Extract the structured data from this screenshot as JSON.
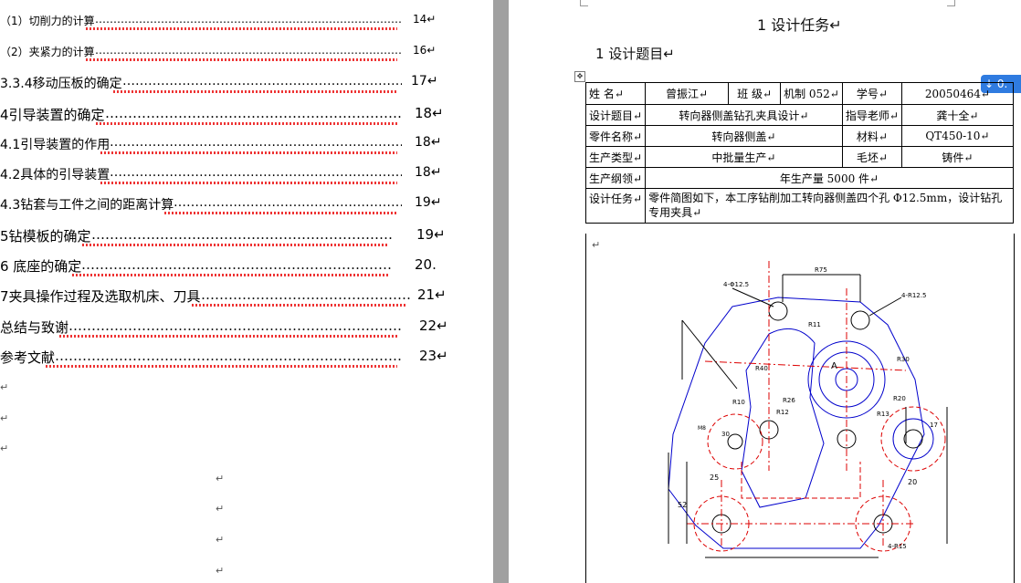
{
  "toc": [
    {
      "text": "（1）切削力的计算",
      "page": "14↵"
    },
    {
      "text": "（2）夹紧力的计算",
      "page": "16↵"
    },
    {
      "text": "3.3.4移动压板的确定",
      "page": "17↵"
    },
    {
      "text": "4引导装置的确定",
      "page": "18↵"
    },
    {
      "text": "4.1引导装置的作用",
      "page": "18↵"
    },
    {
      "text": "4.2具体的引导装置",
      "page": "18↵"
    },
    {
      "text": "4.3钻套与工件之间的距离计算",
      "page": "19↵"
    },
    {
      "text": "5钻模板的确定",
      "page": "19↵"
    },
    {
      "text": "6 底座的确定",
      "page": "20."
    },
    {
      "text": "7夹具操作过程及选取机床、刀具",
      "page": "21↵"
    },
    {
      "text": "总结与致谢",
      "page": "22↵"
    },
    {
      "text": "参考文献",
      "page": "23↵"
    }
  ],
  "marks": {
    "para": "↵",
    "move": "✥",
    "dots": "……………………………………………………………………………………………………………………"
  },
  "right": {
    "heading1": "1 设计任务↵",
    "heading2": "1 设计题目↵",
    "badge": "↓ 0."
  },
  "table": {
    "r1": [
      "姓   名↵",
      "曾振江↵",
      "班  级↵",
      "机制 052↵",
      "学号↵",
      "20050464↵"
    ],
    "r2": [
      "设计题目↵",
      "转向器侧盖钻孔夹具设计↵",
      "指导老师↵",
      "龚十全↵"
    ],
    "r3": [
      "零件名称↵",
      "转向器侧盖↵",
      "材料↵",
      "QT450-10↵"
    ],
    "r4": [
      "生产类型↵",
      "中批量生产↵",
      "毛坯↵",
      "铸件↵"
    ],
    "r5": [
      "生产纲领↵",
      "年生产量    5000     件↵"
    ],
    "r6": [
      "设计任务↵",
      "零件简图如下，本工序钻削加工转向器侧盖四个孔 Φ12.5mm，设计钻孔专用夹具↵"
    ]
  },
  "drawing": {
    "labels": [
      "4-R12.5",
      "4-Φ12.5",
      "R11",
      "R75",
      "R30",
      "R26",
      "R12",
      "R10",
      "R13",
      "R20",
      "A",
      "17",
      "20",
      "25",
      "52",
      "30",
      "4-R15",
      "M8",
      "R40"
    ]
  }
}
